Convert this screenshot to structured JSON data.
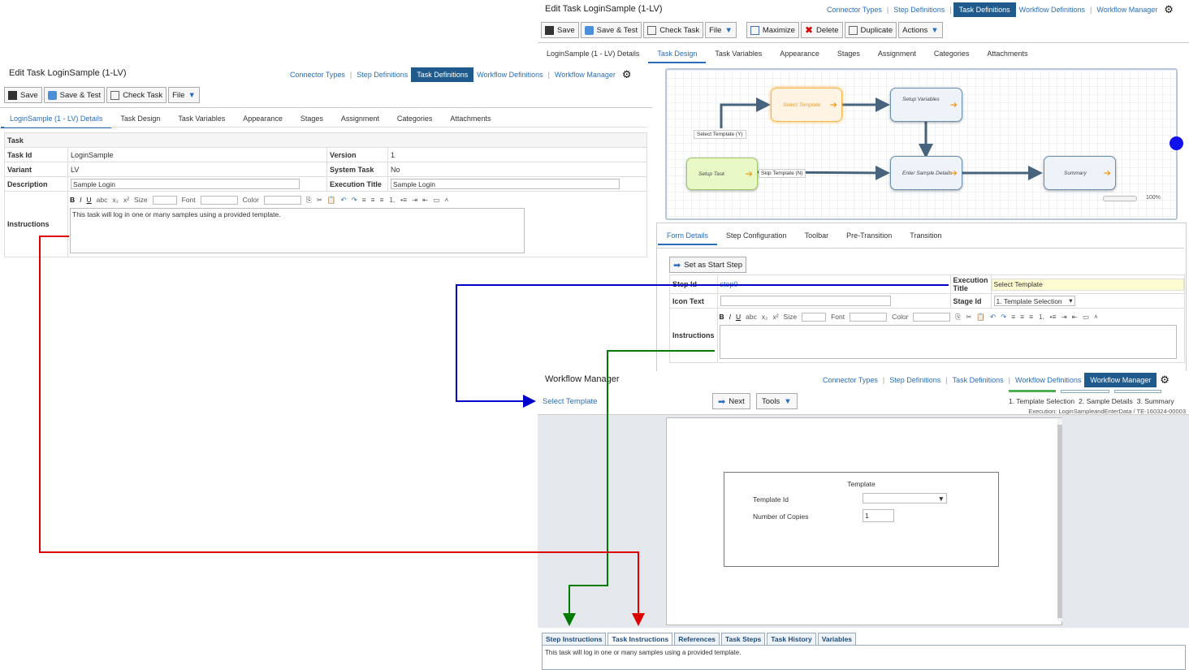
{
  "nav": {
    "connector_types": "Connector Types",
    "step_definitions": "Step Definitions",
    "task_definitions": "Task Definitions",
    "workflow_definitions": "Workflow Definitions",
    "workflow_manager": "Workflow Manager"
  },
  "left_window": {
    "title": "Edit Task LoginSample (1-LV)",
    "toolbar": {
      "save": "Save",
      "save_test": "Save & Test",
      "check_task": "Check Task",
      "file": "File"
    },
    "tabs": [
      "LoginSample (1 - LV) Details",
      "Task Design",
      "Task Variables",
      "Appearance",
      "Stages",
      "Assignment",
      "Categories",
      "Attachments"
    ],
    "section": "Task",
    "fields": {
      "task_id_label": "Task Id",
      "task_id": "LoginSample",
      "version_label": "Version",
      "version": "1",
      "variant_label": "Variant",
      "variant": "LV",
      "system_task_label": "System Task",
      "system_task": "No",
      "description_label": "Description",
      "description": "Sample Login",
      "execution_title_label": "Execution Title",
      "execution_title": "Sample Login",
      "instructions_label": "Instructions",
      "instructions": "This task will log in one or many samples using a provided template."
    }
  },
  "editor": {
    "size": "Size",
    "font": "Font",
    "color": "Color"
  },
  "right_window": {
    "title": "Edit Task LoginSample (1-LV)",
    "toolbar": {
      "save": "Save",
      "save_test": "Save & Test",
      "check_task": "Check Task",
      "file": "File",
      "maximize": "Maximize",
      "delete": "Delete",
      "duplicate": "Duplicate",
      "actions": "Actions"
    },
    "tabs": [
      "LoginSample (1 - LV) Details",
      "Task Design",
      "Task Variables",
      "Appearance",
      "Stages",
      "Assignment",
      "Categories",
      "Attachments"
    ],
    "diagram": {
      "nodes": {
        "setup_task": "Setup Task",
        "select_template": "Select Template",
        "setup_variables": "Setup Variables",
        "enter_sample_details": "Enter Sample Details",
        "summary": "Summary"
      },
      "edges": {
        "select_template_y": "Select Template (Y)",
        "skip_template_n": "Skip Template (N)"
      },
      "zoom": "100%"
    },
    "form_tabs": [
      "Form Details",
      "Step Configuration",
      "Toolbar",
      "Pre-Transition",
      "Transition"
    ],
    "set_start": "Set as Start Step",
    "step_id_label": "Step Id",
    "step_id": "step0",
    "execution_title_label": "Execution Title",
    "execution_title": "Select Template",
    "icon_text_label": "Icon Text",
    "stage_id_label": "Stage Id",
    "stage_id": "1. Template Selection",
    "instructions_label": "Instructions"
  },
  "wf_manager": {
    "title": "Workflow Manager",
    "current_step": "Select Template",
    "next": "Next",
    "tools": "Tools",
    "steps": [
      "1. Template Selection",
      "2. Sample Details",
      "3. Summary"
    ],
    "execution": "Execution: LoginSampleandEnterData / TE-160324-00003",
    "form": {
      "legend": "Template",
      "template_id_label": "Template Id",
      "copies_label": "Number of Copies",
      "copies": "1"
    },
    "bottom_tabs": [
      "Step Instructions",
      "Task Instructions",
      "References",
      "Task Steps",
      "Task History",
      "Variables"
    ],
    "bottom_text": "This task will log in one or many samples using a provided template."
  },
  "colors": {
    "nav_active": "#1e5a8c",
    "link": "#2a6ebb",
    "blue_arrow": "#0000cc",
    "green_arrow": "#007a00",
    "red_arrow": "#dd0000"
  }
}
